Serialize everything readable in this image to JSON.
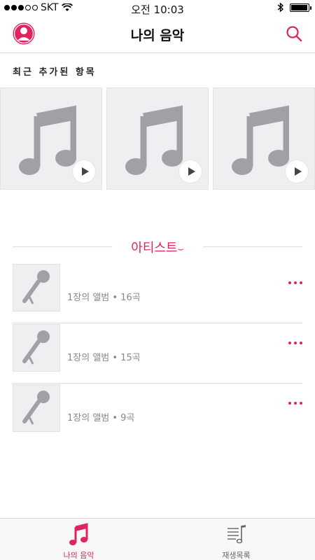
{
  "status_bar": {
    "carrier": "SKT",
    "time": "오전 10:03",
    "battery_level": 0.95
  },
  "header": {
    "title": "나의 음악",
    "left_icon": "profile-icon",
    "right_icon": "search-icon"
  },
  "recent": {
    "label": "최근 추가된 항목",
    "albums": [
      {
        "icon": "music-note-icon"
      },
      {
        "icon": "music-note-icon"
      },
      {
        "icon": "music-note-icon"
      }
    ]
  },
  "artists": {
    "header": "아티스트",
    "items": [
      {
        "subtitle": "1장의 앨범 • 16곡"
      },
      {
        "subtitle": "1장의 앨범 • 15곡"
      },
      {
        "subtitle": "1장의 앨범 • 9곡"
      }
    ]
  },
  "tabs": [
    {
      "label": "나의 음악",
      "icon": "music-note-icon",
      "active": true
    },
    {
      "label": "재생목록",
      "icon": "playlist-icon",
      "active": false
    }
  ],
  "colors": {
    "accent": "#e0245e",
    "placeholder": "#efeff2",
    "icon_gray": "#a0a0a5"
  }
}
